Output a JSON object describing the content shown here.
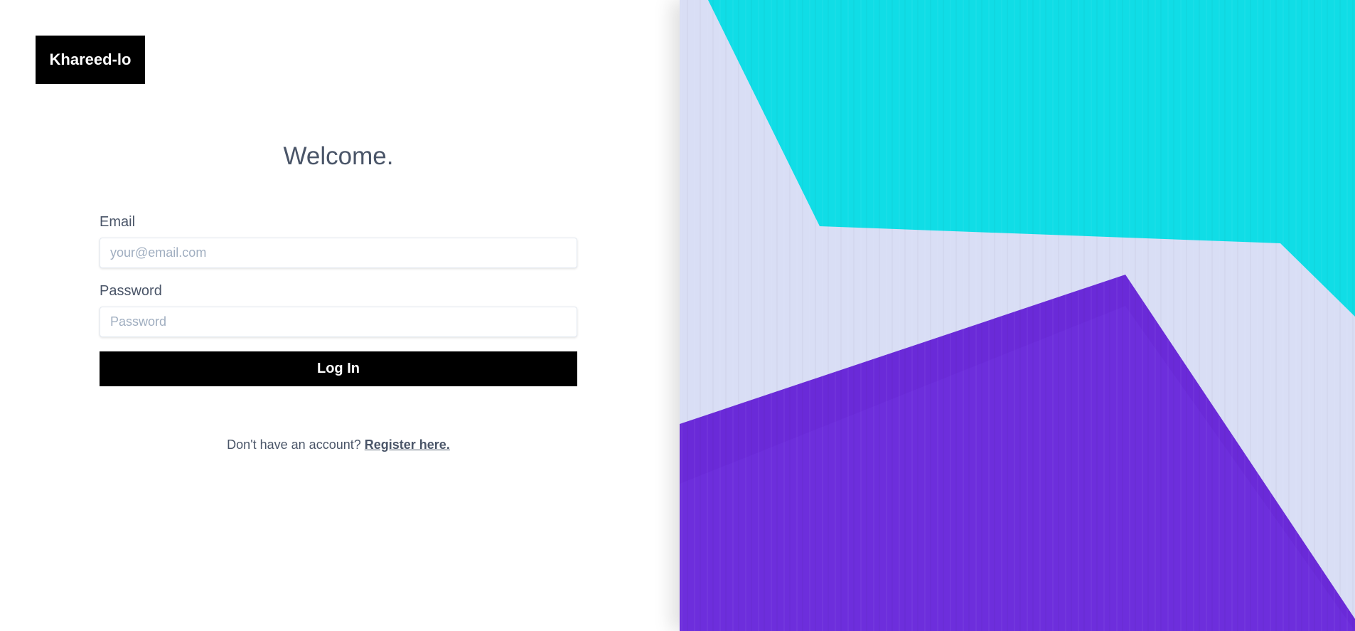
{
  "brand": {
    "name": "Khareed-lo"
  },
  "heading": {
    "title": "Welcome."
  },
  "form": {
    "email_label": "Email",
    "email_placeholder": "your@email.com",
    "email_value": "",
    "password_label": "Password",
    "password_placeholder": "Password",
    "password_value": "",
    "submit_label": "Log In"
  },
  "register": {
    "prompt": "Don't have an account?",
    "link_label": "Register here."
  },
  "colors": {
    "brand_bg": "#000000",
    "text": "#4a5568",
    "art_cyan": "#10dde6",
    "art_pale": "#d9def5",
    "art_purple": "#6a2ad8"
  }
}
